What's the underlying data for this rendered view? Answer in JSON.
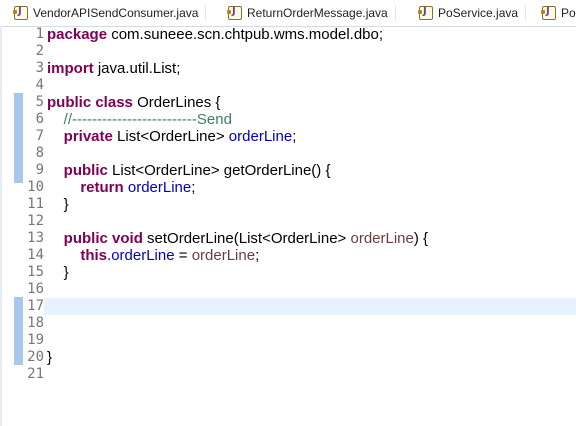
{
  "tabs": [
    {
      "label": "VendorAPISendConsumer.java"
    },
    {
      "label": "ReturnOrderMessage.java"
    },
    {
      "label": "PoService.java"
    },
    {
      "label": "Po"
    }
  ],
  "code": {
    "package_kw": "package",
    "package_name": "com.suneee.scn.chtpub.wms.model.dbo;",
    "import_kw": "import",
    "import_name": "java.util.List;",
    "public_kw": "public",
    "class_kw": "class",
    "class_name": "OrderLines {",
    "comment": "//-------------------------Send",
    "private_kw": "private",
    "field_type": "List<OrderLine>",
    "field_name": "orderLine",
    "semicolon": ";",
    "void_kw": "void",
    "getter_sig": "List<OrderLine> getOrderLine() {",
    "return_kw": "return",
    "close_brace": "}",
    "setter_sig": "setOrderLine(List<OrderLine>",
    "setter_close": ") {",
    "this_kw": "this",
    "dot": ".",
    "assign": " = "
  },
  "line_numbers": [
    "1",
    "2",
    "3",
    "4",
    "5",
    "6",
    "7",
    "8",
    "9",
    "10",
    "11",
    "12",
    "13",
    "14",
    "15",
    "16",
    "17",
    "18",
    "19",
    "20",
    "21"
  ],
  "colors": {
    "keyword": "#7f0055",
    "field": "#0000c0",
    "comment": "#3f7f5f",
    "current_line": "#e8f2fe"
  }
}
